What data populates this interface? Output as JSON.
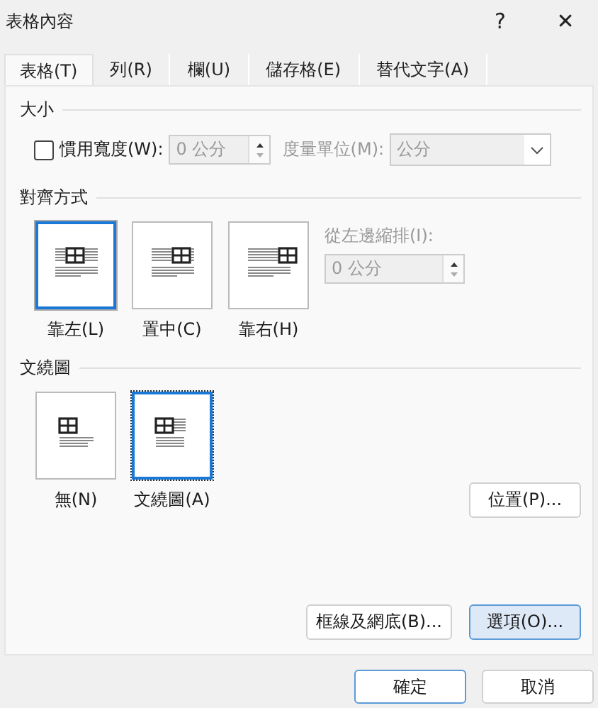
{
  "window": {
    "title": "表格內容",
    "help": "?",
    "close": "✕"
  },
  "tabs": [
    {
      "label": "表格(T)",
      "selected": true
    },
    {
      "label": "列(R)",
      "selected": false
    },
    {
      "label": "欄(U)",
      "selected": false
    },
    {
      "label": "儲存格(E)",
      "selected": false
    },
    {
      "label": "替代文字(A)",
      "selected": false
    }
  ],
  "size": {
    "heading": "大小",
    "preferred_width": {
      "label": "慣用寬度(W):",
      "checked": false,
      "value": "0 公分",
      "disabled": true
    },
    "unit": {
      "label": "度量單位(M):",
      "value": "公分",
      "disabled": true
    }
  },
  "alignment": {
    "heading": "對齊方式",
    "options": [
      {
        "label": "靠左(L)",
        "kind": "left",
        "selected": true
      },
      {
        "label": "置中(C)",
        "kind": "center",
        "selected": false
      },
      {
        "label": "靠右(H)",
        "kind": "right",
        "selected": false
      }
    ],
    "indent": {
      "label": "從左邊縮排(I):",
      "value": "0 公分",
      "disabled": true
    }
  },
  "wrapping": {
    "heading": "文繞圖",
    "options": [
      {
        "label": "無(N)",
        "kind": "none",
        "selected": false
      },
      {
        "label": "文繞圖(A)",
        "kind": "around",
        "selected": true
      }
    ],
    "position_button": "位置(P)..."
  },
  "panel_buttons": [
    {
      "label": "框線及網底(B)...",
      "selected": false
    },
    {
      "label": "選項(O)...",
      "selected": true
    }
  ],
  "dialog_buttons": [
    {
      "label": "確定",
      "selected": true
    },
    {
      "label": "取消",
      "selected": false
    }
  ]
}
